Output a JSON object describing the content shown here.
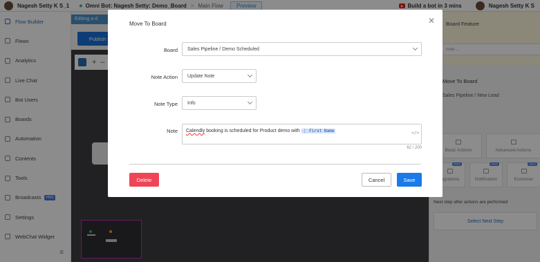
{
  "topbar": {
    "user_name": "Nagesh Setty K S_1",
    "bot_title": "Omni Bot: Nagesh Setty: Demo_Board",
    "separator": ">",
    "flow_name": "Main Flow",
    "preview_label": "Preview",
    "build_label": "Build a bot in 3 mins",
    "right_user_name": "Nagesh Setty K S"
  },
  "sidebar": {
    "items": [
      {
        "label": "Flow Builder",
        "icon": "flow-builder-icon"
      },
      {
        "label": "Flows",
        "icon": "flows-icon"
      },
      {
        "label": "Analytics",
        "icon": "analytics-icon"
      },
      {
        "label": "Live Chat",
        "icon": "live-chat-icon"
      },
      {
        "label": "Bot Users",
        "icon": "bot-users-icon"
      },
      {
        "label": "Boards",
        "icon": "boards-icon"
      },
      {
        "label": "Automation",
        "icon": "automation-icon"
      },
      {
        "label": "Contents",
        "icon": "contents-icon"
      },
      {
        "label": "Tools",
        "icon": "tools-icon"
      },
      {
        "label": "Broadcasts",
        "icon": "broadcasts-icon",
        "badge": "PRO"
      },
      {
        "label": "Settings",
        "icon": "settings-icon"
      },
      {
        "label": "WebChat Widget",
        "icon": "webchat-widget-icon"
      }
    ],
    "menu_glyph": "≡"
  },
  "canvas": {
    "editing_label": "Editing a d",
    "publish_label": "Publish",
    "plus_glyph": "+",
    "minus_glyph": "–"
  },
  "right_panel": {
    "feature_label": "Board Feature",
    "field_placeholder": "note ...",
    "title": "Move To Board",
    "subtitle": "Sales Pipeline / New Lead",
    "cards": [
      {
        "label": "Basic Actions"
      },
      {
        "label": "Advanced Actions"
      },
      {
        "label": "ngrations",
        "badge": "PRO"
      },
      {
        "label": "Notification",
        "badge": "PRO"
      },
      {
        "label": "Ecommer",
        "badge": "PRO"
      }
    ],
    "next_step_text": "Next step after actions are performed",
    "select_next_label": "Select Next Step"
  },
  "modal": {
    "title": "Move To Board",
    "close_glyph": "✕",
    "board": {
      "label": "Board",
      "value": "Sales Pipeline / Demo Scheduled"
    },
    "note_action": {
      "label": "Note Action",
      "value": "Update Note"
    },
    "note_type": {
      "label": "Note Type",
      "value": "Info"
    },
    "note": {
      "label": "Note",
      "text_misspelled": "Calendly",
      "text_rest": " booking is scheduled for Product demo with ",
      "chip": "⋮ First Name",
      "code_glyph": "</>",
      "counter": "62 / 200"
    },
    "delete_label": "Delete",
    "cancel_label": "Cancel",
    "save_label": "Save"
  },
  "colors": {
    "primary": "#1a7ae8",
    "danger": "#f04457",
    "overlay": "rgba(0,0,0,0.45)"
  }
}
